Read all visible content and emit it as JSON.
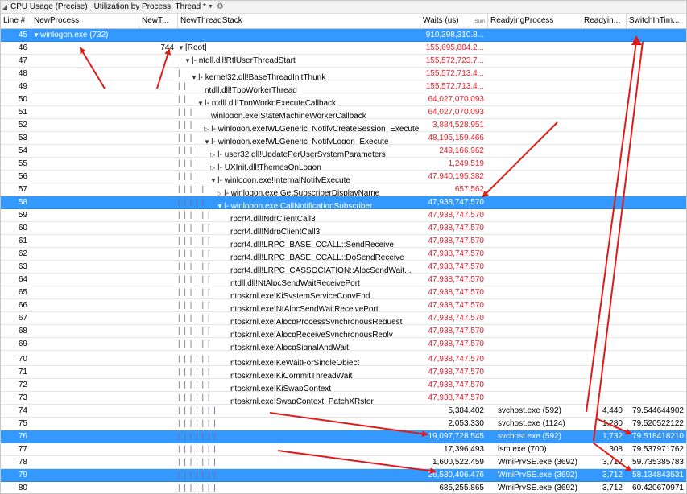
{
  "toolbar": {
    "title": "CPU Usage (Precise)",
    "preset": "Utilization by Process, Thread *",
    "gear_icon": "gear-icon"
  },
  "columns": {
    "line": "Line #",
    "process": "NewProcess",
    "thread_id": "NewT...",
    "stack": "NewThreadStack",
    "waits": "Waits (us)",
    "waits_sum": "Sum",
    "readying_process": "ReadyingProcess",
    "readying_thread": "Readyin...",
    "switch_in": "SwitchInTim..."
  },
  "rows": [
    {
      "line": "45",
      "process": "winlogon.exe (732)",
      "tid": "",
      "stack": "",
      "waits": "910,398,310.8...",
      "rp": "",
      "rt": "",
      "sw": "",
      "sel": true,
      "red": false,
      "indent": 0,
      "exp": "▼"
    },
    {
      "line": "46",
      "process": "",
      "tid": "744",
      "stack": "[Root]",
      "waits": "155,695,884.2...",
      "rp": "",
      "rt": "",
      "sw": "",
      "sel": false,
      "red": true,
      "indent": 0,
      "exp": "▼"
    },
    {
      "line": "47",
      "process": "",
      "tid": "",
      "stack": "|- ntdll.dll!RtlUserThreadStart",
      "waits": "155,572,723.7...",
      "rp": "",
      "rt": "",
      "sw": "",
      "sel": false,
      "red": true,
      "indent": 1,
      "exp": "▼"
    },
    {
      "line": "48",
      "process": "",
      "tid": "",
      "stack": "|- kernel32.dll!BaseThreadInitThunk",
      "waits": "155,572,713.4...",
      "rp": "",
      "rt": "",
      "sw": "",
      "sel": false,
      "red": true,
      "indent": 2,
      "exp": "▼"
    },
    {
      "line": "49",
      "process": "",
      "tid": "",
      "stack": "ntdll.dll!TppWorkerThread",
      "waits": "155,572,713.4...",
      "rp": "",
      "rt": "",
      "sw": "",
      "sel": false,
      "red": true,
      "indent": 3,
      "exp": ""
    },
    {
      "line": "50",
      "process": "",
      "tid": "",
      "stack": "|- ntdll.dll!TppWorkpExecuteCallback",
      "waits": "64,027,070.093",
      "rp": "",
      "rt": "",
      "sw": "",
      "sel": false,
      "red": true,
      "indent": 3,
      "exp": "▼"
    },
    {
      "line": "51",
      "process": "",
      "tid": "",
      "stack": "winlogon.exe!StateMachineWorkerCallback",
      "waits": "64,027,070.093",
      "rp": "",
      "rt": "",
      "sw": "",
      "sel": false,
      "red": true,
      "indent": 4,
      "exp": ""
    },
    {
      "line": "52",
      "process": "",
      "tid": "",
      "stack": "|- winlogon.exe!WLGeneric_NotifyCreateSession_Execute",
      "waits": "3,884,528.951",
      "rp": "",
      "rt": "",
      "sw": "",
      "sel": false,
      "red": true,
      "indent": 4,
      "exp": "▷"
    },
    {
      "line": "53",
      "process": "",
      "tid": "",
      "stack": "|- winlogon.exe!WLGeneric_NotifyLogon_Execute",
      "waits": "48,195,159.466",
      "rp": "",
      "rt": "",
      "sw": "",
      "sel": false,
      "red": true,
      "indent": 4,
      "exp": "▼"
    },
    {
      "line": "54",
      "process": "",
      "tid": "",
      "stack": "|- user32.dll!UpdatePerUserSystemParameters",
      "waits": "249,166.962",
      "rp": "",
      "rt": "",
      "sw": "",
      "sel": false,
      "red": true,
      "indent": 5,
      "exp": "▷"
    },
    {
      "line": "55",
      "process": "",
      "tid": "",
      "stack": "|- UXInit.dll!ThemesOnLogon",
      "waits": "1,249.519",
      "rp": "",
      "rt": "",
      "sw": "",
      "sel": false,
      "red": true,
      "indent": 5,
      "exp": "▷"
    },
    {
      "line": "56",
      "process": "",
      "tid": "",
      "stack": "|- winlogon.exe!InternalNotifyExecute",
      "waits": "47,940,195.382",
      "rp": "",
      "rt": "",
      "sw": "",
      "sel": false,
      "red": true,
      "indent": 5,
      "exp": "▼"
    },
    {
      "line": "57",
      "process": "",
      "tid": "",
      "stack": "|- winlogon.exe!GetSubscriberDisplayName",
      "waits": "657.562",
      "rp": "",
      "rt": "",
      "sw": "",
      "sel": false,
      "red": true,
      "indent": 6,
      "exp": "▷"
    },
    {
      "line": "58",
      "process": "",
      "tid": "",
      "stack": "|- winlogon.exe!CallNotificationSubscriber",
      "waits": "47,938,747.570",
      "rp": "",
      "rt": "",
      "sw": "",
      "sel": true,
      "red": true,
      "indent": 6,
      "exp": "▼"
    },
    {
      "line": "59",
      "process": "",
      "tid": "",
      "stack": "rpcrt4.dll!NdrClientCall3",
      "waits": "47,938,747.570",
      "rp": "",
      "rt": "",
      "sw": "",
      "sel": false,
      "red": true,
      "indent": 7,
      "exp": ""
    },
    {
      "line": "60",
      "process": "",
      "tid": "",
      "stack": "rpcrt4.dll!NdrpClientCall3",
      "waits": "47,938,747.570",
      "rp": "",
      "rt": "",
      "sw": "",
      "sel": false,
      "red": true,
      "indent": 7,
      "exp": ""
    },
    {
      "line": "61",
      "process": "",
      "tid": "",
      "stack": "rpcrt4.dll!LRPC_BASE_CCALL::SendReceive",
      "waits": "47,938,747.570",
      "rp": "",
      "rt": "",
      "sw": "",
      "sel": false,
      "red": true,
      "indent": 7,
      "exp": ""
    },
    {
      "line": "62",
      "process": "",
      "tid": "",
      "stack": "rpcrt4.dll!LRPC_BASE_CCALL::DoSendReceive",
      "waits": "47,938,747.570",
      "rp": "",
      "rt": "",
      "sw": "",
      "sel": false,
      "red": true,
      "indent": 7,
      "exp": ""
    },
    {
      "line": "63",
      "process": "",
      "tid": "",
      "stack": "rpcrt4.dll!LRPC_CASSOCIATION::AlpcSendWait...",
      "waits": "47,938,747.570",
      "rp": "",
      "rt": "",
      "sw": "",
      "sel": false,
      "red": true,
      "indent": 7,
      "exp": ""
    },
    {
      "line": "64",
      "process": "",
      "tid": "",
      "stack": "ntdll.dll!NtAlpcSendWaitReceivePort",
      "waits": "47,938,747.570",
      "rp": "",
      "rt": "",
      "sw": "",
      "sel": false,
      "red": true,
      "indent": 7,
      "exp": ""
    },
    {
      "line": "65",
      "process": "",
      "tid": "",
      "stack": "ntoskrnl.exe!KiSystemServiceCopyEnd",
      "waits": "47,938,747.570",
      "rp": "",
      "rt": "",
      "sw": "",
      "sel": false,
      "red": true,
      "indent": 7,
      "exp": ""
    },
    {
      "line": "66",
      "process": "",
      "tid": "",
      "stack": "ntoskrnl.exe!NtAlpcSendWaitReceivePort",
      "waits": "47,938,747.570",
      "rp": "",
      "rt": "",
      "sw": "",
      "sel": false,
      "red": true,
      "indent": 7,
      "exp": ""
    },
    {
      "line": "67",
      "process": "",
      "tid": "",
      "stack": "ntoskrnl.exe!AlpcpProcessSynchronousRequest",
      "waits": "47,938,747.570",
      "rp": "",
      "rt": "",
      "sw": "",
      "sel": false,
      "red": true,
      "indent": 7,
      "exp": ""
    },
    {
      "line": "68",
      "process": "",
      "tid": "",
      "stack": "ntoskrnl.exe!AlpcpReceiveSynchronousReply",
      "waits": "47,938,747.570",
      "rp": "",
      "rt": "",
      "sw": "",
      "sel": false,
      "red": true,
      "indent": 7,
      "exp": ""
    },
    {
      "line": "69",
      "process": "",
      "tid": "",
      "stack": "ntoskrnl.exe!AlpcpSignalAndWait",
      "waits": "47,938,747.570",
      "rp": "",
      "rt": "",
      "sw": "",
      "sel": false,
      "red": true,
      "indent": 7,
      "exp": ""
    },
    {
      "line": "70",
      "process": "",
      "tid": "",
      "stack": "ntoskrnl.exe!KeWaitForSingleObject",
      "waits": "47,938,747.570",
      "rp": "",
      "rt": "",
      "sw": "",
      "sel": false,
      "red": true,
      "indent": 7,
      "exp": ""
    },
    {
      "line": "71",
      "process": "",
      "tid": "",
      "stack": "ntoskrnl.exe!KiCommitThreadWait",
      "waits": "47,938,747.570",
      "rp": "",
      "rt": "",
      "sw": "",
      "sel": false,
      "red": true,
      "indent": 7,
      "exp": ""
    },
    {
      "line": "72",
      "process": "",
      "tid": "",
      "stack": "ntoskrnl.exe!KiSwapContext",
      "waits": "47,938,747.570",
      "rp": "",
      "rt": "",
      "sw": "",
      "sel": false,
      "red": true,
      "indent": 7,
      "exp": ""
    },
    {
      "line": "73",
      "process": "",
      "tid": "",
      "stack": "ntoskrnl.exe!SwapContext_PatchXRstor",
      "waits": "47,938,747.570",
      "rp": "",
      "rt": "",
      "sw": "",
      "sel": false,
      "red": true,
      "indent": 7,
      "exp": ""
    },
    {
      "line": "74",
      "process": "",
      "tid": "",
      "stack": "",
      "waits": "5,384.402",
      "rp": "svchost.exe (592)",
      "rt": "4,440",
      "sw": "79.544644902",
      "sel": false,
      "red": false,
      "indent": 8,
      "exp": ""
    },
    {
      "line": "75",
      "process": "",
      "tid": "",
      "stack": "",
      "waits": "2,053.330",
      "rp": "svchost.exe (1124)",
      "rt": "1,280",
      "sw": "79.520522122",
      "sel": false,
      "red": false,
      "indent": 8,
      "exp": ""
    },
    {
      "line": "76",
      "process": "",
      "tid": "",
      "stack": "",
      "waits": "19,097,728.545",
      "rp": "svchost.exe (592)",
      "rt": "1,732",
      "sw": "79.518418210",
      "sel": true,
      "red": false,
      "indent": 8,
      "exp": ""
    },
    {
      "line": "77",
      "process": "",
      "tid": "",
      "stack": "",
      "waits": "17,396.493",
      "rp": "lsm.exe (700)",
      "rt": "308",
      "sw": "79.537971762",
      "sel": false,
      "red": false,
      "indent": 8,
      "exp": ""
    },
    {
      "line": "78",
      "process": "",
      "tid": "",
      "stack": "",
      "waits": "1,600,522.459",
      "rp": "WmiPrvSE.exe (3692)",
      "rt": "3,712",
      "sw": "59.735385783",
      "sel": false,
      "red": false,
      "indent": 8,
      "exp": ""
    },
    {
      "line": "79",
      "process": "",
      "tid": "",
      "stack": "",
      "waits": "26,530,406.476",
      "rp": "WmiPrvSE.exe (3692)",
      "rt": "3,712",
      "sw": "58.134843531",
      "sel": true,
      "red": false,
      "indent": 8,
      "exp": ""
    },
    {
      "line": "80",
      "process": "",
      "tid": "",
      "stack": "",
      "waits": "685,255.865",
      "rp": "WmiPrvSE.exe (3692)",
      "rt": "3,712",
      "sw": "60.420670971",
      "sel": false,
      "red": false,
      "indent": 8,
      "exp": ""
    }
  ],
  "colors": {
    "selection": "#3399ff",
    "stack_red": "#e8202a",
    "annotation_red": "#e11a1a"
  }
}
